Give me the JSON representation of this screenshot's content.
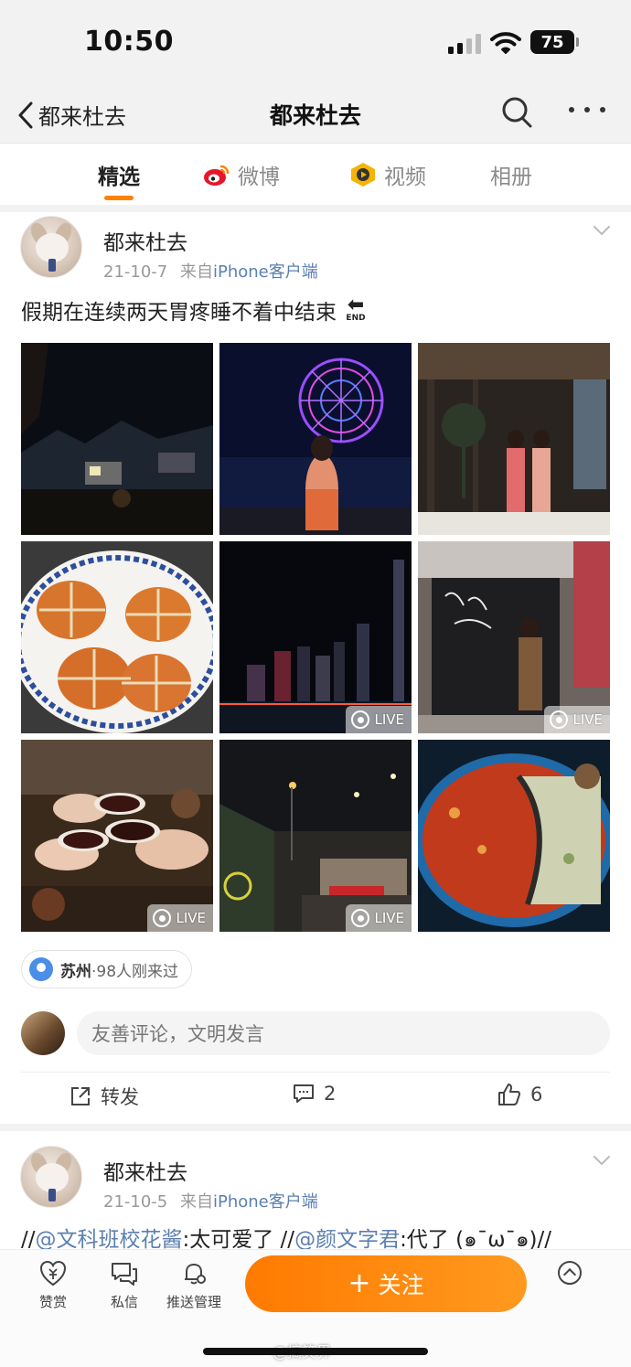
{
  "status_bar": {
    "time": "10:50",
    "battery": "75"
  },
  "nav": {
    "back_label": "都来杜去",
    "title": "都来杜去"
  },
  "tabs": [
    {
      "label": "精选",
      "active": true
    },
    {
      "label": "微博",
      "icon": "weibo-logo-icon"
    },
    {
      "label": "视频",
      "icon": "video-logo-icon"
    },
    {
      "label": "相册"
    }
  ],
  "post1": {
    "author": "都来杜去",
    "date": "21-10-7",
    "source_prefix": "来自",
    "source": "iPhone客户端",
    "text": "假期在连续两天胃疼睡不着中结束",
    "end_badge": "END",
    "photos": [
      {
        "name": "night-lake-villa",
        "live": false
      },
      {
        "name": "ferris-wheel-night",
        "live": false
      },
      {
        "name": "two-friends-lobby",
        "live": false
      },
      {
        "name": "hairy-crabs-plate",
        "live": false
      },
      {
        "name": "city-skyline-night",
        "live": true
      },
      {
        "name": "poster-board-selfie",
        "live": true
      },
      {
        "name": "toasting-cups",
        "live": true
      },
      {
        "name": "night-street-stall",
        "live": true
      },
      {
        "name": "hotpot",
        "live": false
      }
    ],
    "live_label": "LIVE",
    "location": {
      "city": "苏州",
      "passed": "·98人刚来过"
    },
    "comment_placeholder": "友善评论，文明发言",
    "actions": {
      "repost": "转发",
      "comments": "2",
      "likes": "6"
    }
  },
  "post2": {
    "author": "都来杜去",
    "date": "21-10-5",
    "source_prefix": "来自",
    "source": "iPhone客户端",
    "text_parts": [
      "//",
      "@文科班校花酱",
      ":太可爱了 //",
      "@颜文字君",
      ":代了 (๑¯ω¯๑)//"
    ]
  },
  "bottom_bar": {
    "reward": "赞赏",
    "message": "私信",
    "push": "推送管理",
    "follow": "关注",
    "follow_plus": "+",
    "watermark": "@搞笑界"
  },
  "colors": {
    "accent": "#ff8200",
    "link": "#5b7fb0"
  }
}
